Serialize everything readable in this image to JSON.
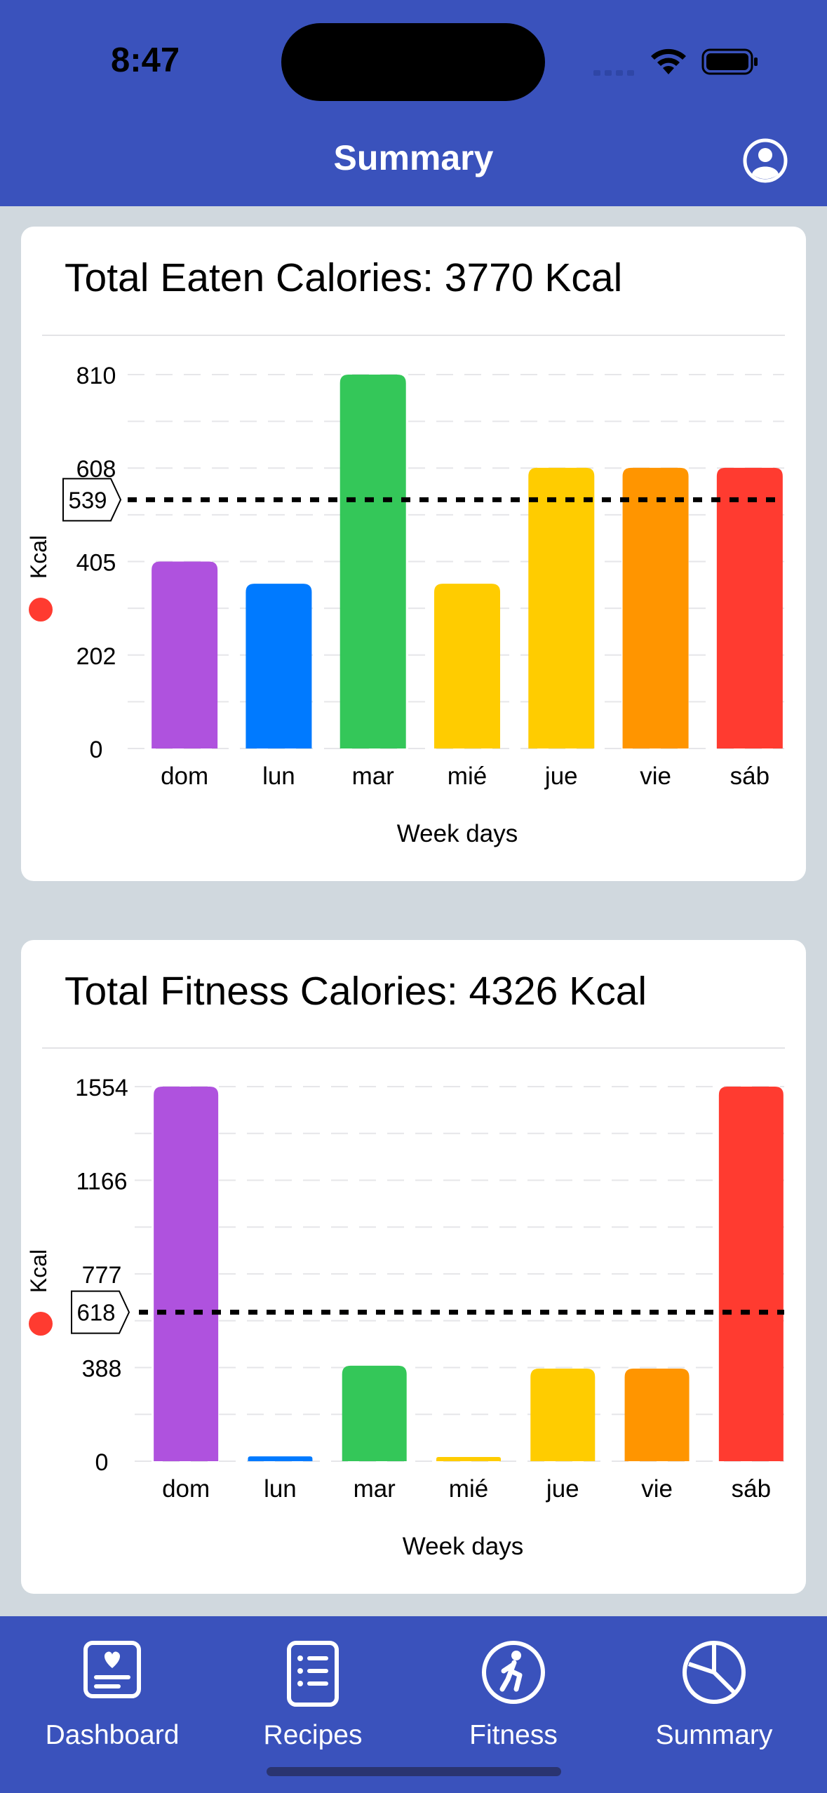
{
  "status_bar": {
    "time": "8:47"
  },
  "header": {
    "title": "Summary",
    "profile_icon": "person-circle-icon"
  },
  "charts": {
    "eaten": {
      "title": "Total Eaten Calories: 3770 Kcal",
      "chart_data": {
        "type": "bar",
        "categories": [
          "dom",
          "lun",
          "mar",
          "mié",
          "jue",
          "vie",
          "sáb"
        ],
        "values": [
          405,
          357,
          810,
          357,
          608,
          608,
          608
        ],
        "colors": [
          "#AF52DE",
          "#007AFF",
          "#34C759",
          "#FFCC00",
          "#FFCC00",
          "#FF9500",
          "#FF3B30"
        ],
        "yticks": [
          0,
          202,
          405,
          608,
          810
        ],
        "ylim": [
          0,
          810
        ],
        "average": 539,
        "xlabel": "Week days",
        "ylabel": "Kcal",
        "legend_dot_color": "#FF3B30"
      }
    },
    "fitness": {
      "title": "Total Fitness Calories: 4326 Kcal",
      "chart_data": {
        "type": "bar",
        "categories": [
          "dom",
          "lun",
          "mar",
          "mié",
          "jue",
          "vie",
          "sáb"
        ],
        "values": [
          1554,
          20,
          396,
          12,
          384,
          384,
          1554
        ],
        "colors": [
          "#AF52DE",
          "#007AFF",
          "#34C759",
          "#FFCC00",
          "#FFCC00",
          "#FF9500",
          "#FF3B30"
        ],
        "yticks": [
          0,
          388,
          777,
          1166,
          1554
        ],
        "ylim": [
          0,
          1554
        ],
        "average": 618,
        "xlabel": "Week days",
        "ylabel": "Kcal",
        "legend_dot_color": "#FF3B30"
      }
    }
  },
  "tabbar": {
    "tabs": [
      {
        "label": "Dashboard",
        "icon": "dashboard-icon"
      },
      {
        "label": "Recipes",
        "icon": "recipes-list-icon"
      },
      {
        "label": "Fitness",
        "icon": "fitness-walk-icon"
      },
      {
        "label": "Summary",
        "icon": "pie-chart-icon"
      }
    ]
  },
  "colors": {
    "accent": "#3A52BC",
    "background": "#D0D8DE"
  }
}
